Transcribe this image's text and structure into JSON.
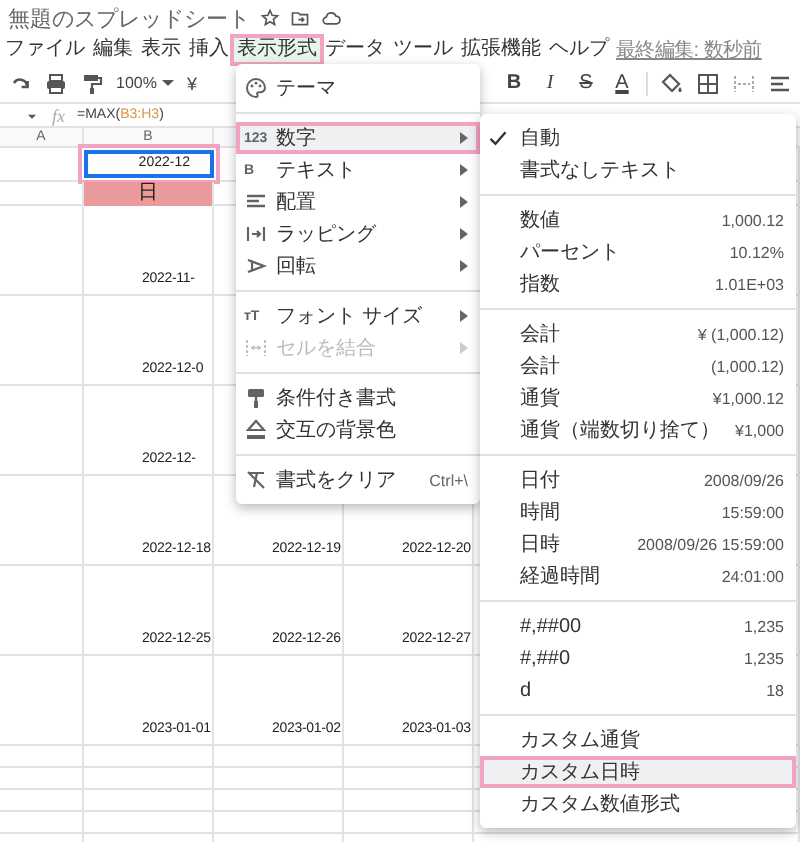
{
  "title": "無題のスプレッドシート",
  "menubar": [
    {
      "label": "ファイル",
      "selected": false
    },
    {
      "label": "編集",
      "selected": false
    },
    {
      "label": "表示",
      "selected": false
    },
    {
      "label": "挿入",
      "selected": false
    },
    {
      "label": "表示形式",
      "selected": true
    },
    {
      "label": "データ",
      "selected": false
    },
    {
      "label": "ツール",
      "selected": false
    },
    {
      "label": "拡張機能",
      "selected": false
    },
    {
      "label": "ヘルプ",
      "selected": false
    }
  ],
  "last_edit": "最終編集: 数秒前",
  "toolbar": {
    "zoom": "100%",
    "currency": "¥",
    "format_buttons": [
      {
        "label": "B",
        "kind": "bold"
      },
      {
        "label": "I",
        "kind": "italic"
      },
      {
        "label": "S",
        "kind": "strike"
      },
      {
        "label": "A",
        "kind": "color"
      }
    ]
  },
  "formula_bar": {
    "fx": "fx",
    "prefix": "=MAX(",
    "range": "B3:H3",
    "suffix": ")"
  },
  "columns": [
    "A",
    "B"
  ],
  "rows": [
    {
      "kind": "active",
      "highlighted": true,
      "cells": [
        "2022-12"
      ]
    },
    {
      "kind": "band",
      "highlighted": false,
      "cells": [
        "日"
      ]
    },
    {
      "kind": "dates",
      "highlighted": false,
      "cells": [
        "2022-11-"
      ]
    },
    {
      "kind": "dates",
      "highlighted": false,
      "cells": [
        "2022-12-0"
      ]
    },
    {
      "kind": "dates",
      "highlighted": false,
      "cells": [
        "2022-12-"
      ]
    },
    {
      "kind": "dates",
      "highlighted": false,
      "cells": [
        "2022-12-18",
        "2022-12-19",
        "2022-12-20"
      ]
    },
    {
      "kind": "dates",
      "highlighted": false,
      "cells": [
        "2022-12-25",
        "2022-12-26",
        "2022-12-27"
      ]
    },
    {
      "kind": "dates",
      "highlighted": false,
      "cells": [
        "2023-01-01",
        "2023-01-02",
        "2023-01-03"
      ]
    }
  ],
  "format_menu": {
    "groups": [
      [
        {
          "label": "テーマ",
          "kind": "palette",
          "submenu": false,
          "disabled": false,
          "highlighted": false
        }
      ],
      [
        {
          "label": "数字",
          "kind": "glyph",
          "glyph": "123",
          "submenu": true,
          "disabled": false,
          "highlighted": true
        },
        {
          "label": "テキスト",
          "kind": "glyph",
          "glyph": "B",
          "submenu": true,
          "disabled": false,
          "highlighted": false
        },
        {
          "label": "配置",
          "kind": "align",
          "submenu": true,
          "disabled": false,
          "highlighted": false
        },
        {
          "label": "ラッピング",
          "kind": "wrap",
          "submenu": true,
          "disabled": false,
          "highlighted": false
        },
        {
          "label": "回転",
          "kind": "rotate",
          "submenu": true,
          "disabled": false,
          "highlighted": false
        }
      ],
      [
        {
          "label": "フォント サイズ",
          "kind": "glyph",
          "glyph": "тT",
          "submenu": true,
          "disabled": false,
          "highlighted": false
        },
        {
          "label": "セルを結合",
          "kind": "merge",
          "submenu": true,
          "disabled": true,
          "highlighted": false
        }
      ],
      [
        {
          "label": "条件付き書式",
          "kind": "conditional",
          "submenu": false,
          "disabled": false,
          "highlighted": false
        },
        {
          "label": "交互の背景色",
          "kind": "alternate",
          "submenu": false,
          "disabled": false,
          "highlighted": false
        }
      ],
      [
        {
          "label": "書式をクリア",
          "kind": "clear",
          "shortcut": "Ctrl+\\",
          "submenu": false,
          "disabled": false,
          "highlighted": false
        }
      ]
    ]
  },
  "number_menu": {
    "groups": [
      [
        {
          "label": "自動",
          "checked": true,
          "highlighted": false
        },
        {
          "label": "書式なしテキスト",
          "checked": false,
          "highlighted": false
        }
      ],
      [
        {
          "label": "数値",
          "sample": "1,000.12",
          "checked": false,
          "highlighted": false
        },
        {
          "label": "パーセント",
          "sample": "10.12%",
          "checked": false,
          "highlighted": false
        },
        {
          "label": "指数",
          "sample": "1.01E+03",
          "checked": false,
          "highlighted": false
        }
      ],
      [
        {
          "label": "会計",
          "sample": "¥ (1,000.12)",
          "checked": false,
          "highlighted": false
        },
        {
          "label": "会計",
          "sample": "(1,000.12)",
          "checked": false,
          "highlighted": false
        },
        {
          "label": "通貨",
          "sample": "¥1,000.12",
          "checked": false,
          "highlighted": false
        },
        {
          "label": "通貨（端数切り捨て）",
          "sample": "¥1,000",
          "checked": false,
          "highlighted": false
        }
      ],
      [
        {
          "label": "日付",
          "sample": "2008/09/26",
          "checked": false,
          "highlighted": false
        },
        {
          "label": "時間",
          "sample": "15:59:00",
          "checked": false,
          "highlighted": false
        },
        {
          "label": "日時",
          "sample": "2008/09/26 15:59:00",
          "checked": false,
          "highlighted": false
        },
        {
          "label": "経過時間",
          "sample": "24:01:00",
          "checked": false,
          "highlighted": false
        }
      ],
      [
        {
          "label": "#,##00",
          "sample": "1,235",
          "checked": false,
          "highlighted": false
        },
        {
          "label": "#,##0",
          "sample": "1,235",
          "checked": false,
          "highlighted": false
        },
        {
          "label": "d",
          "sample": "18",
          "checked": false,
          "highlighted": false
        }
      ],
      [
        {
          "label": "カスタム通貨",
          "checked": false,
          "highlighted": false
        },
        {
          "label": "カスタム日時",
          "checked": false,
          "highlighted": true
        },
        {
          "label": "カスタム数値形式",
          "checked": false,
          "highlighted": false
        }
      ]
    ]
  }
}
